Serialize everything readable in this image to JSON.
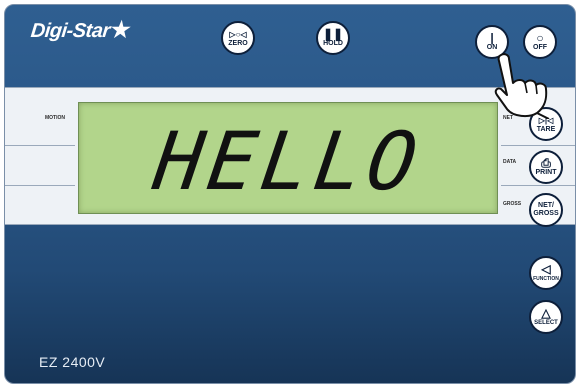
{
  "brand": {
    "logo_text": "Digi-Star",
    "logo_mark": "★"
  },
  "top_buttons": {
    "zero": {
      "glyph": "▷○◁",
      "label": "ZERO"
    },
    "hold": {
      "glyph": "❚❚",
      "label": "HOLD"
    },
    "on": {
      "glyph": "|",
      "label": "ON"
    },
    "off": {
      "glyph": "○",
      "label": "OFF"
    }
  },
  "indicators": {
    "motion": "MOTION",
    "net": "NET",
    "data": "DATA",
    "gross": "GROSS"
  },
  "display": {
    "text": "HELLO"
  },
  "side_buttons": {
    "tare": {
      "glyph": "▷|◁",
      "label": "TARE"
    },
    "print": {
      "glyph": "⎙",
      "label": "PRINT"
    },
    "net_gross": {
      "label": "NET/\nGROSS"
    },
    "function": {
      "glyph": "◁",
      "label": "FUNCTION"
    },
    "select": {
      "glyph": "△",
      "label": "SELECT"
    }
  },
  "model": "EZ 2400V",
  "colors": {
    "panel": "#2a5686",
    "lcd": "#b2d58b",
    "band": "#eef2f6"
  }
}
